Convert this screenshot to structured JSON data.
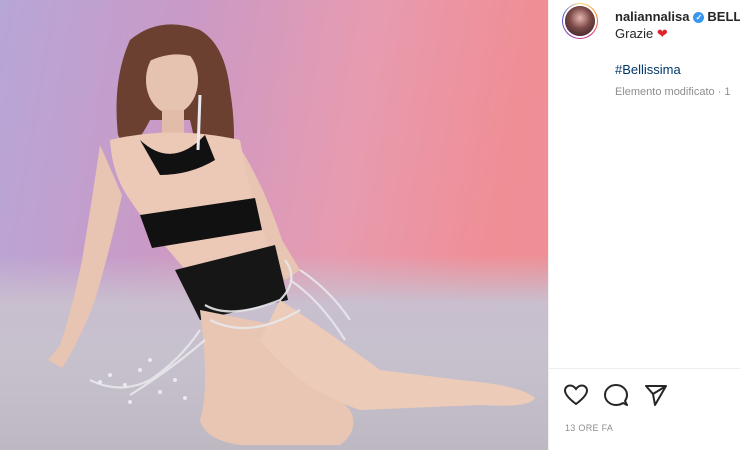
{
  "post": {
    "username": "naliannalisa",
    "username_tail": "BELLI",
    "caption": "Grazie",
    "caption_emoji": "❤",
    "hashtag": "#Bellissima",
    "edited_label": "Elemento modificato · 1",
    "timestamp": "13 ORE FA"
  },
  "icons": {
    "like": "heart-outline-icon",
    "comment": "comment-bubble-icon",
    "share": "paper-plane-icon",
    "verified": "verified-badge-icon"
  },
  "colors": {
    "verified": "#3897f0",
    "heart": "#e0242b",
    "hashtag": "#00376b",
    "muted": "#8e8e8e"
  }
}
